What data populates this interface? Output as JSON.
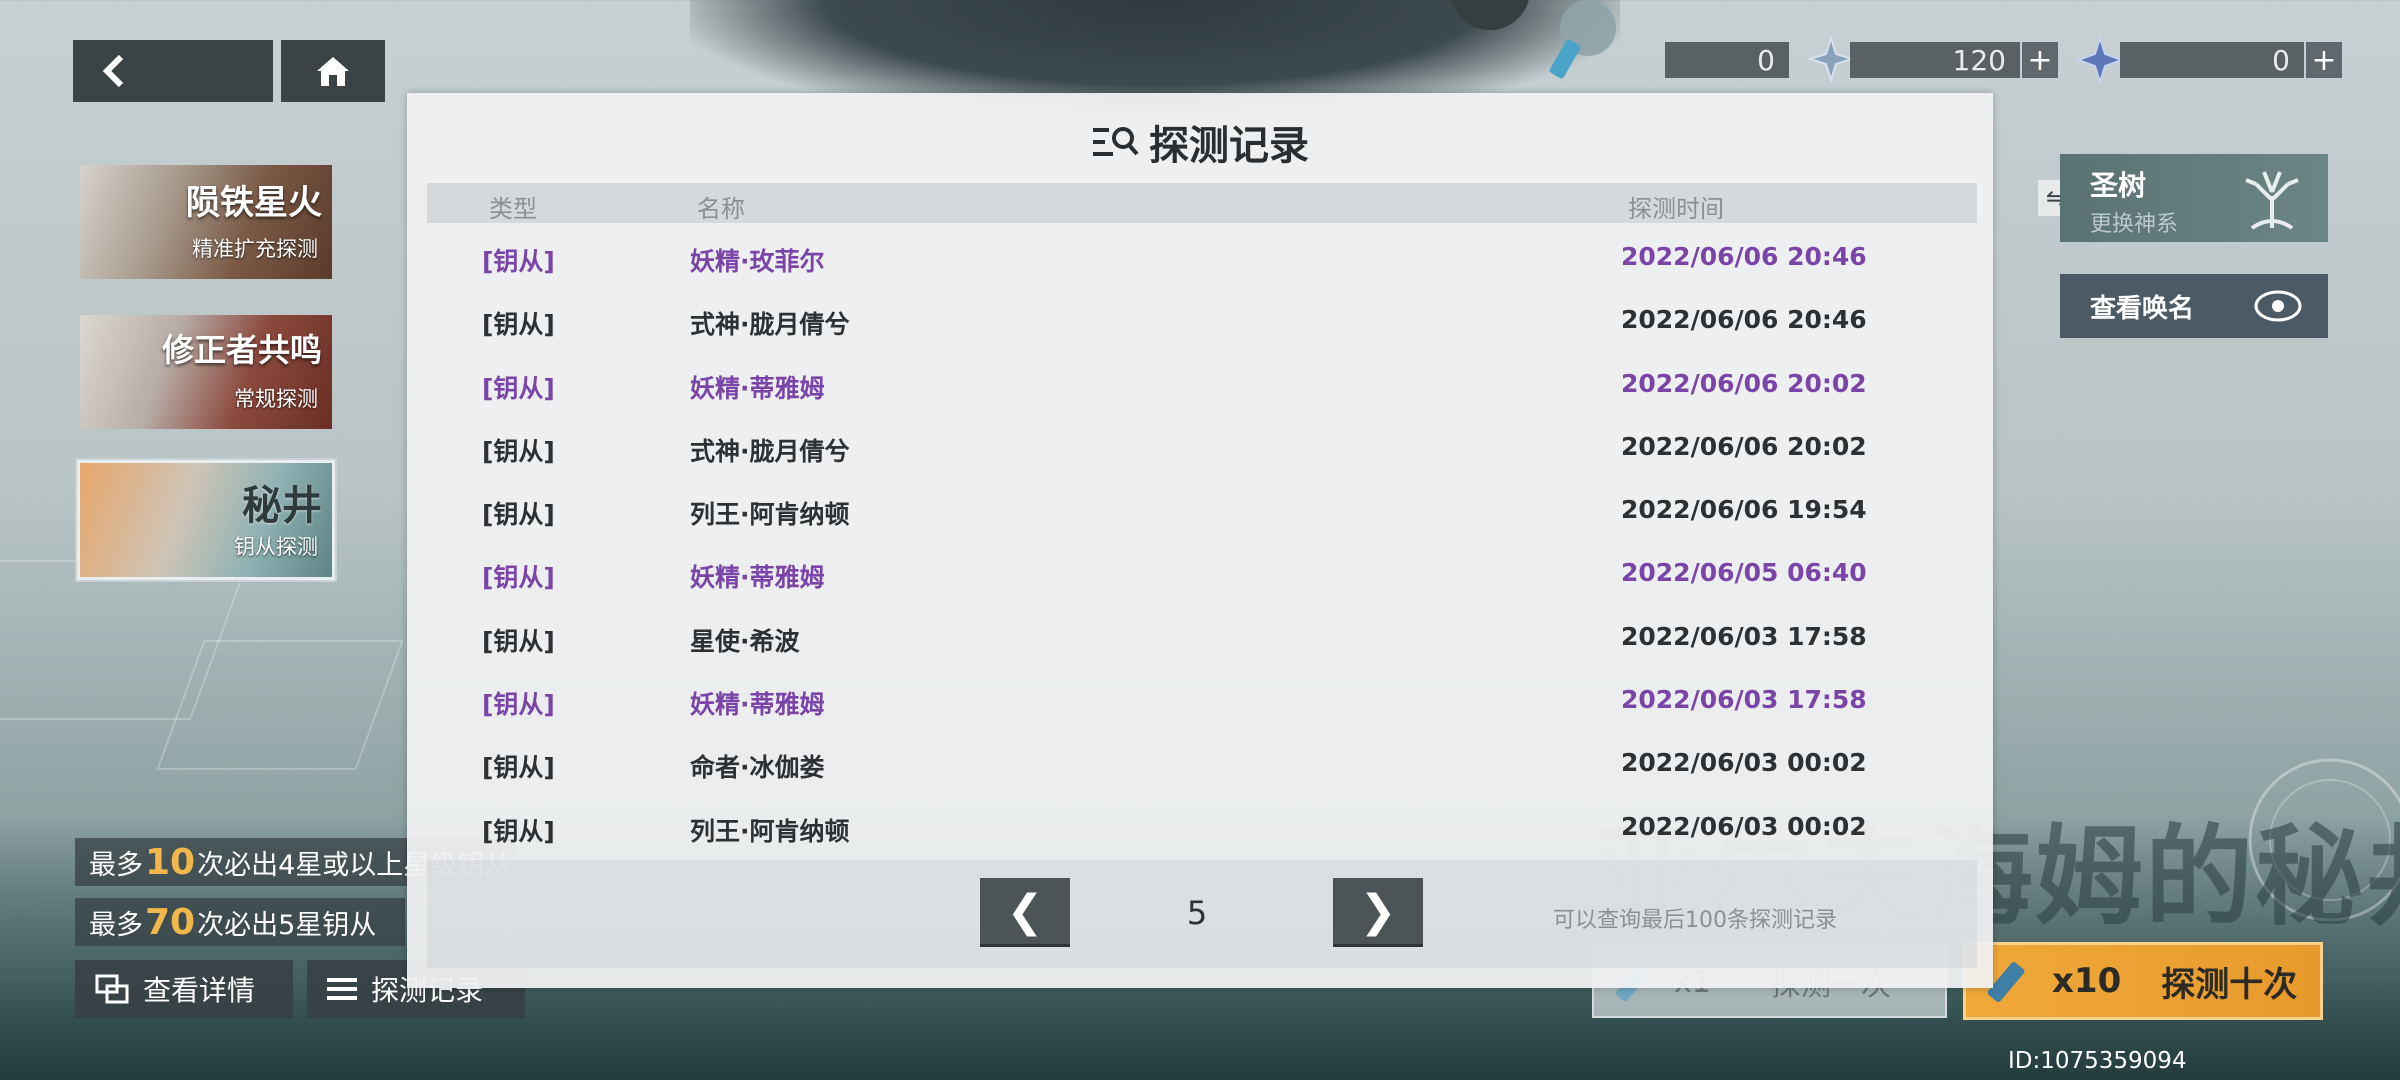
{
  "top_nav": {
    "back_icon": "chevron-left-icon",
    "home_icon": "home-icon"
  },
  "currencies": [
    {
      "icon": "key-crystal-icon",
      "value": "0"
    },
    {
      "icon": "star-shard-icon",
      "value": "120"
    },
    {
      "icon": "blue-star-icon",
      "value": "0"
    }
  ],
  "banners": [
    {
      "title": "陨铁星火",
      "subtitle": "精准扩充探测"
    },
    {
      "title": "修正者共鸣",
      "subtitle": "常规探测"
    },
    {
      "title": "秘井",
      "subtitle": "钥从探测"
    }
  ],
  "right_panel": {
    "tree_title": "圣树",
    "tree_subtitle": "更换神系",
    "view_name": "查看唤名"
  },
  "guarantees": [
    {
      "prefix": "最多",
      "num": "10",
      "suffix": "次必出4星或以上星级钥从"
    },
    {
      "prefix": "最多",
      "num": "70",
      "suffix": "次必出5星钥从"
    }
  ],
  "bottom_buttons": {
    "details": "查看详情",
    "records": "探测记录"
  },
  "draw": {
    "single_count": "x1",
    "single_label": "探测一次",
    "ten_count": "x10",
    "ten_label": "探测十次",
    "banner_title": "亚尔夫海姆的秘井"
  },
  "user_id": "ID:1075359094",
  "modal": {
    "title": "探测记录",
    "headers": {
      "type": "类型",
      "name": "名称",
      "time": "探测时间"
    },
    "records": [
      {
        "type": "[钥从]",
        "name": "妖精·玫菲尔",
        "time": "2022/06/06 20:46",
        "highlight": true
      },
      {
        "type": "[钥从]",
        "name": "式神·胧月倩兮",
        "time": "2022/06/06 20:46",
        "highlight": false
      },
      {
        "type": "[钥从]",
        "name": "妖精·蒂雅姆",
        "time": "2022/06/06 20:02",
        "highlight": true
      },
      {
        "type": "[钥从]",
        "name": "式神·胧月倩兮",
        "time": "2022/06/06 20:02",
        "highlight": false
      },
      {
        "type": "[钥从]",
        "name": "列王·阿肯纳顿",
        "time": "2022/06/06 19:54",
        "highlight": false
      },
      {
        "type": "[钥从]",
        "name": "妖精·蒂雅姆",
        "time": "2022/06/05 06:40",
        "highlight": true
      },
      {
        "type": "[钥从]",
        "name": "星使·希波",
        "time": "2022/06/03 17:58",
        "highlight": false
      },
      {
        "type": "[钥从]",
        "name": "妖精·蒂雅姆",
        "time": "2022/06/03 17:58",
        "highlight": true
      },
      {
        "type": "[钥从]",
        "name": "命者·冰伽娄",
        "time": "2022/06/03 00:02",
        "highlight": false
      },
      {
        "type": "[钥从]",
        "name": "列王·阿肯纳顿",
        "time": "2022/06/03 00:02",
        "highlight": false
      }
    ],
    "pager": {
      "prev": "❮",
      "page": "5",
      "next": "❯",
      "note": "可以查询最后100条探测记录"
    }
  },
  "colors": {
    "highlight": "#7a44a8",
    "accent_gold": "#f0b84a",
    "draw_orange": "#e79a2c"
  }
}
